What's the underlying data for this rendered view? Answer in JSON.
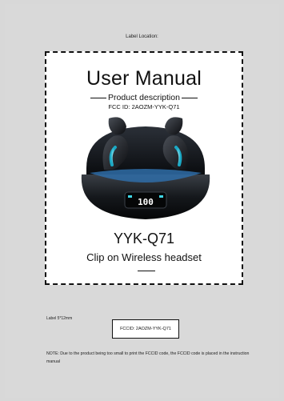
{
  "page": {
    "label_location": "Label Location:",
    "label_size": "Label 5*12mm",
    "note": "NOTE:   Due to the product being too small to print the FCCID code, the FCCID code is placed in the instruction manual"
  },
  "label": {
    "title": "User Manual",
    "description_heading": "Product description",
    "fcc_id": "FCC ID: 2AOZM-YYK-Q71",
    "display_readout": "100",
    "model": "YYK-Q71",
    "subtitle": "Clip on Wireless headset"
  },
  "small_label": {
    "fcc_id": "FCCID: 2AOZM-YYK-Q71"
  },
  "colors": {
    "background": "#d9d9d9",
    "accent_cyan": "#3fd6e6"
  }
}
